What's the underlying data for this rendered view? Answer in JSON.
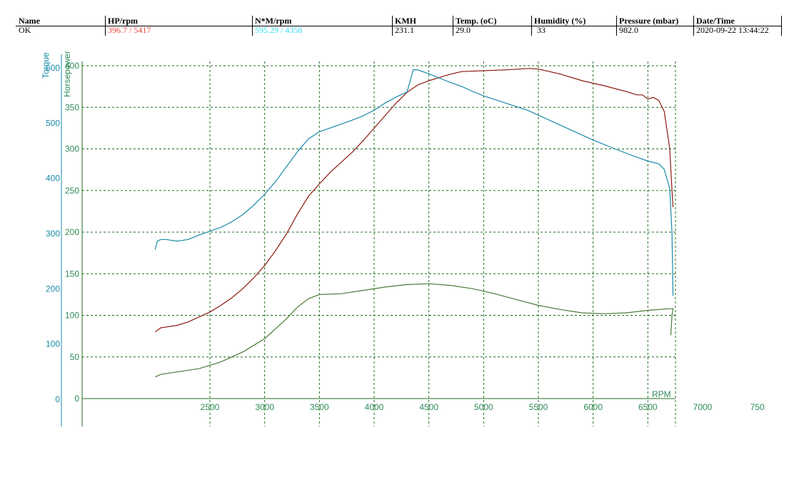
{
  "header": {
    "columns": [
      {
        "label": "Name",
        "value": "OK",
        "color": "#000000"
      },
      {
        "label": "HP/rpm",
        "value": "396.7 / 5417",
        "color": "#e8453c"
      },
      {
        "label": "N*M/rpm",
        "value": "595.29 / 4358",
        "color": "#33e0f0"
      },
      {
        "label": "KMH",
        "value": "231.1",
        "color": "#000000"
      },
      {
        "label": "Temp. (oC)",
        "value": "29.0",
        "color": "#000000"
      },
      {
        "label": "Humidity (%)",
        "value": "33",
        "color": "#000000"
      },
      {
        "label": "Pressure (mbar)",
        "value": "982.0",
        "color": "#000000"
      },
      {
        "label": "Date/Time",
        "value": "2020-09-22 13:44:22",
        "color": "#000000"
      }
    ]
  },
  "chart_data": {
    "type": "line",
    "x_label": "RPM",
    "torque_axis_label": "Torque",
    "hp_axis_label": "Horsepower",
    "x_ticks": [
      "2500",
      "3000",
      "3500",
      "4000",
      "4500",
      "5000",
      "5500",
      "6000",
      "6500",
      "7000",
      "750"
    ],
    "x_range": [
      2000,
      7500
    ],
    "hp_ticks": [
      "0",
      "50",
      "100",
      "150",
      "200",
      "250",
      "300",
      "350",
      "400"
    ],
    "hp_range": [
      0,
      400
    ],
    "torque_ticks": [
      "0",
      "100",
      "200",
      "300",
      "400",
      "500",
      "600"
    ],
    "torque_range": [
      0,
      600
    ],
    "grid": true,
    "colors": {
      "hp": "#8b1a10",
      "torque": "#1a8aa8",
      "other": "#4a7a3a",
      "grid": "#1f6e1f",
      "axis_text": "#2e8b57",
      "torque_text": "#1a8aa8"
    },
    "series": [
      {
        "key": "hp",
        "points": [
          [
            2000,
            80
          ],
          [
            2050,
            85
          ],
          [
            2100,
            86
          ],
          [
            2200,
            88
          ],
          [
            2300,
            92
          ],
          [
            2400,
            98
          ],
          [
            2500,
            104
          ],
          [
            2600,
            112
          ],
          [
            2700,
            121
          ],
          [
            2800,
            132
          ],
          [
            2900,
            145
          ],
          [
            3000,
            160
          ],
          [
            3100,
            178
          ],
          [
            3200,
            198
          ],
          [
            3300,
            222
          ],
          [
            3400,
            243
          ],
          [
            3500,
            258
          ],
          [
            3600,
            272
          ],
          [
            3700,
            284
          ],
          [
            3800,
            296
          ],
          [
            3900,
            310
          ],
          [
            4000,
            325
          ],
          [
            4100,
            340
          ],
          [
            4200,
            355
          ],
          [
            4300,
            368
          ],
          [
            4400,
            377
          ],
          [
            4500,
            382
          ],
          [
            4600,
            386
          ],
          [
            4700,
            390
          ],
          [
            4800,
            393
          ],
          [
            5000,
            394
          ],
          [
            5200,
            395
          ],
          [
            5417,
            396.7
          ],
          [
            5500,
            396
          ],
          [
            5700,
            390
          ],
          [
            5900,
            382
          ],
          [
            6100,
            376
          ],
          [
            6300,
            369
          ],
          [
            6400,
            365
          ],
          [
            6450,
            365
          ],
          [
            6500,
            360
          ],
          [
            6550,
            362
          ],
          [
            6600,
            358
          ],
          [
            6650,
            345
          ],
          [
            6700,
            300
          ],
          [
            6720,
            250
          ],
          [
            6730,
            230
          ]
        ]
      },
      {
        "key": "torque",
        "points": [
          [
            2000,
            270
          ],
          [
            2020,
            285
          ],
          [
            2050,
            288
          ],
          [
            2100,
            288
          ],
          [
            2200,
            285
          ],
          [
            2300,
            288
          ],
          [
            2400,
            296
          ],
          [
            2500,
            303
          ],
          [
            2600,
            310
          ],
          [
            2700,
            320
          ],
          [
            2800,
            333
          ],
          [
            2900,
            350
          ],
          [
            3000,
            370
          ],
          [
            3100,
            393
          ],
          [
            3200,
            420
          ],
          [
            3300,
            447
          ],
          [
            3400,
            470
          ],
          [
            3500,
            483
          ],
          [
            3600,
            490
          ],
          [
            3700,
            497
          ],
          [
            3800,
            504
          ],
          [
            3900,
            512
          ],
          [
            4000,
            522
          ],
          [
            4100,
            535
          ],
          [
            4200,
            546
          ],
          [
            4300,
            555
          ],
          [
            4358,
            595.29
          ],
          [
            4400,
            595
          ],
          [
            4500,
            588
          ],
          [
            4600,
            580
          ],
          [
            4700,
            572
          ],
          [
            4800,
            565
          ],
          [
            4900,
            556
          ],
          [
            5000,
            548
          ],
          [
            5200,
            535
          ],
          [
            5400,
            522
          ],
          [
            5600,
            504
          ],
          [
            5800,
            486
          ],
          [
            6000,
            468
          ],
          [
            6200,
            452
          ],
          [
            6400,
            437
          ],
          [
            6500,
            430
          ],
          [
            6600,
            425
          ],
          [
            6650,
            415
          ],
          [
            6700,
            380
          ],
          [
            6720,
            300
          ],
          [
            6730,
            186
          ]
        ]
      },
      {
        "key": "other",
        "points": [
          [
            2000,
            26
          ],
          [
            2050,
            29
          ],
          [
            2200,
            32
          ],
          [
            2400,
            36
          ],
          [
            2600,
            44
          ],
          [
            2800,
            56
          ],
          [
            3000,
            72
          ],
          [
            3200,
            96
          ],
          [
            3300,
            110
          ],
          [
            3400,
            120
          ],
          [
            3500,
            125
          ],
          [
            3700,
            126
          ],
          [
            3900,
            130
          ],
          [
            4100,
            134
          ],
          [
            4300,
            137
          ],
          [
            4500,
            138
          ],
          [
            4700,
            136
          ],
          [
            4900,
            132
          ],
          [
            5100,
            126
          ],
          [
            5300,
            119
          ],
          [
            5500,
            112
          ],
          [
            5700,
            107
          ],
          [
            5900,
            103
          ],
          [
            6100,
            102
          ],
          [
            6300,
            103
          ],
          [
            6500,
            106
          ],
          [
            6700,
            108
          ],
          [
            6730,
            108
          ],
          [
            6720,
            100
          ],
          [
            6710,
            76
          ]
        ]
      }
    ]
  }
}
